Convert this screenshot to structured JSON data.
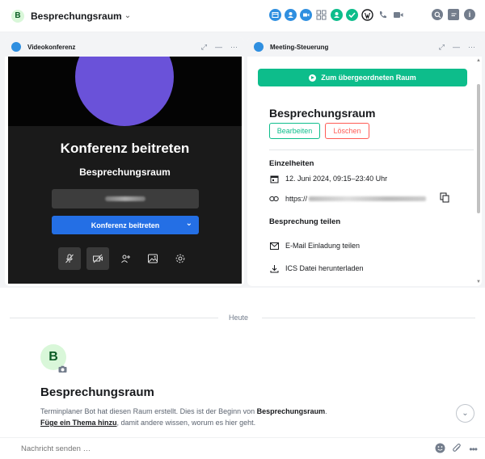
{
  "header": {
    "avatar_letter": "B",
    "room_name": "Besprechungsraum",
    "chevron": "⌄",
    "widget_icons": [
      {
        "name": "calendar-widget-icon",
        "color": "#2f8fe0"
      },
      {
        "name": "people-widget-icon",
        "color": "#2f8fe0"
      },
      {
        "name": "video-widget-icon",
        "color": "#2f8fe0"
      },
      {
        "name": "apps-grid-icon",
        "color": "#737d8c"
      },
      {
        "name": "meeting-widget-icon",
        "color": "#0dbd8b"
      },
      {
        "name": "check-widget-icon",
        "color": "#0dbd8b"
      },
      {
        "name": "wordpress-widget-icon",
        "color": "#17191c"
      },
      {
        "name": "phone-icon",
        "color": "#737d8c"
      },
      {
        "name": "video-call-icon",
        "color": "#737d8c"
      }
    ],
    "right_icons": [
      "search-icon",
      "threads-icon",
      "info-icon"
    ]
  },
  "video_panel": {
    "title": "Videokonferenz",
    "heading": "Konferenz beitreten",
    "room": "Besprechungsraum",
    "join_label": "Konferenz beitreten",
    "dropdown": "⌄"
  },
  "meeting_panel": {
    "title": "Meeting-Steuerung",
    "parent_button": "Zum übergeordneten Raum",
    "meeting_title": "Besprechungsraum",
    "edit_label": "Bearbeiten",
    "delete_label": "Löschen",
    "details_title": "Einzelheiten",
    "date_text": "12. Juni 2024, 09:15–23:40 Uhr",
    "url_prefix": "https://",
    "share_title": "Besprechung teilen",
    "email_label": "E-Mail Einladung teilen",
    "ics_label": "ICS Datei herunterladen"
  },
  "timeline": {
    "date_separator": "Heute",
    "avatar_letter": "B",
    "room_heading": "Besprechungsraum",
    "created_prefix": "Terminplaner Bot hat diesen Raum erstellt. Dies ist der Beginn von ",
    "created_room": "Besprechungsraum",
    "created_suffix": ".",
    "topic_link": "Füge ein Thema hinzu",
    "topic_suffix": ", damit andere wissen, worum es hier geht.",
    "scroll_down": "⌄"
  },
  "composer": {
    "placeholder": "Nachricht senden …"
  },
  "colors": {
    "accent": "#0dbd8b",
    "danger": "#ff5b55",
    "primary_blue": "#246fe5",
    "video_avatar": "#6a52d9"
  }
}
